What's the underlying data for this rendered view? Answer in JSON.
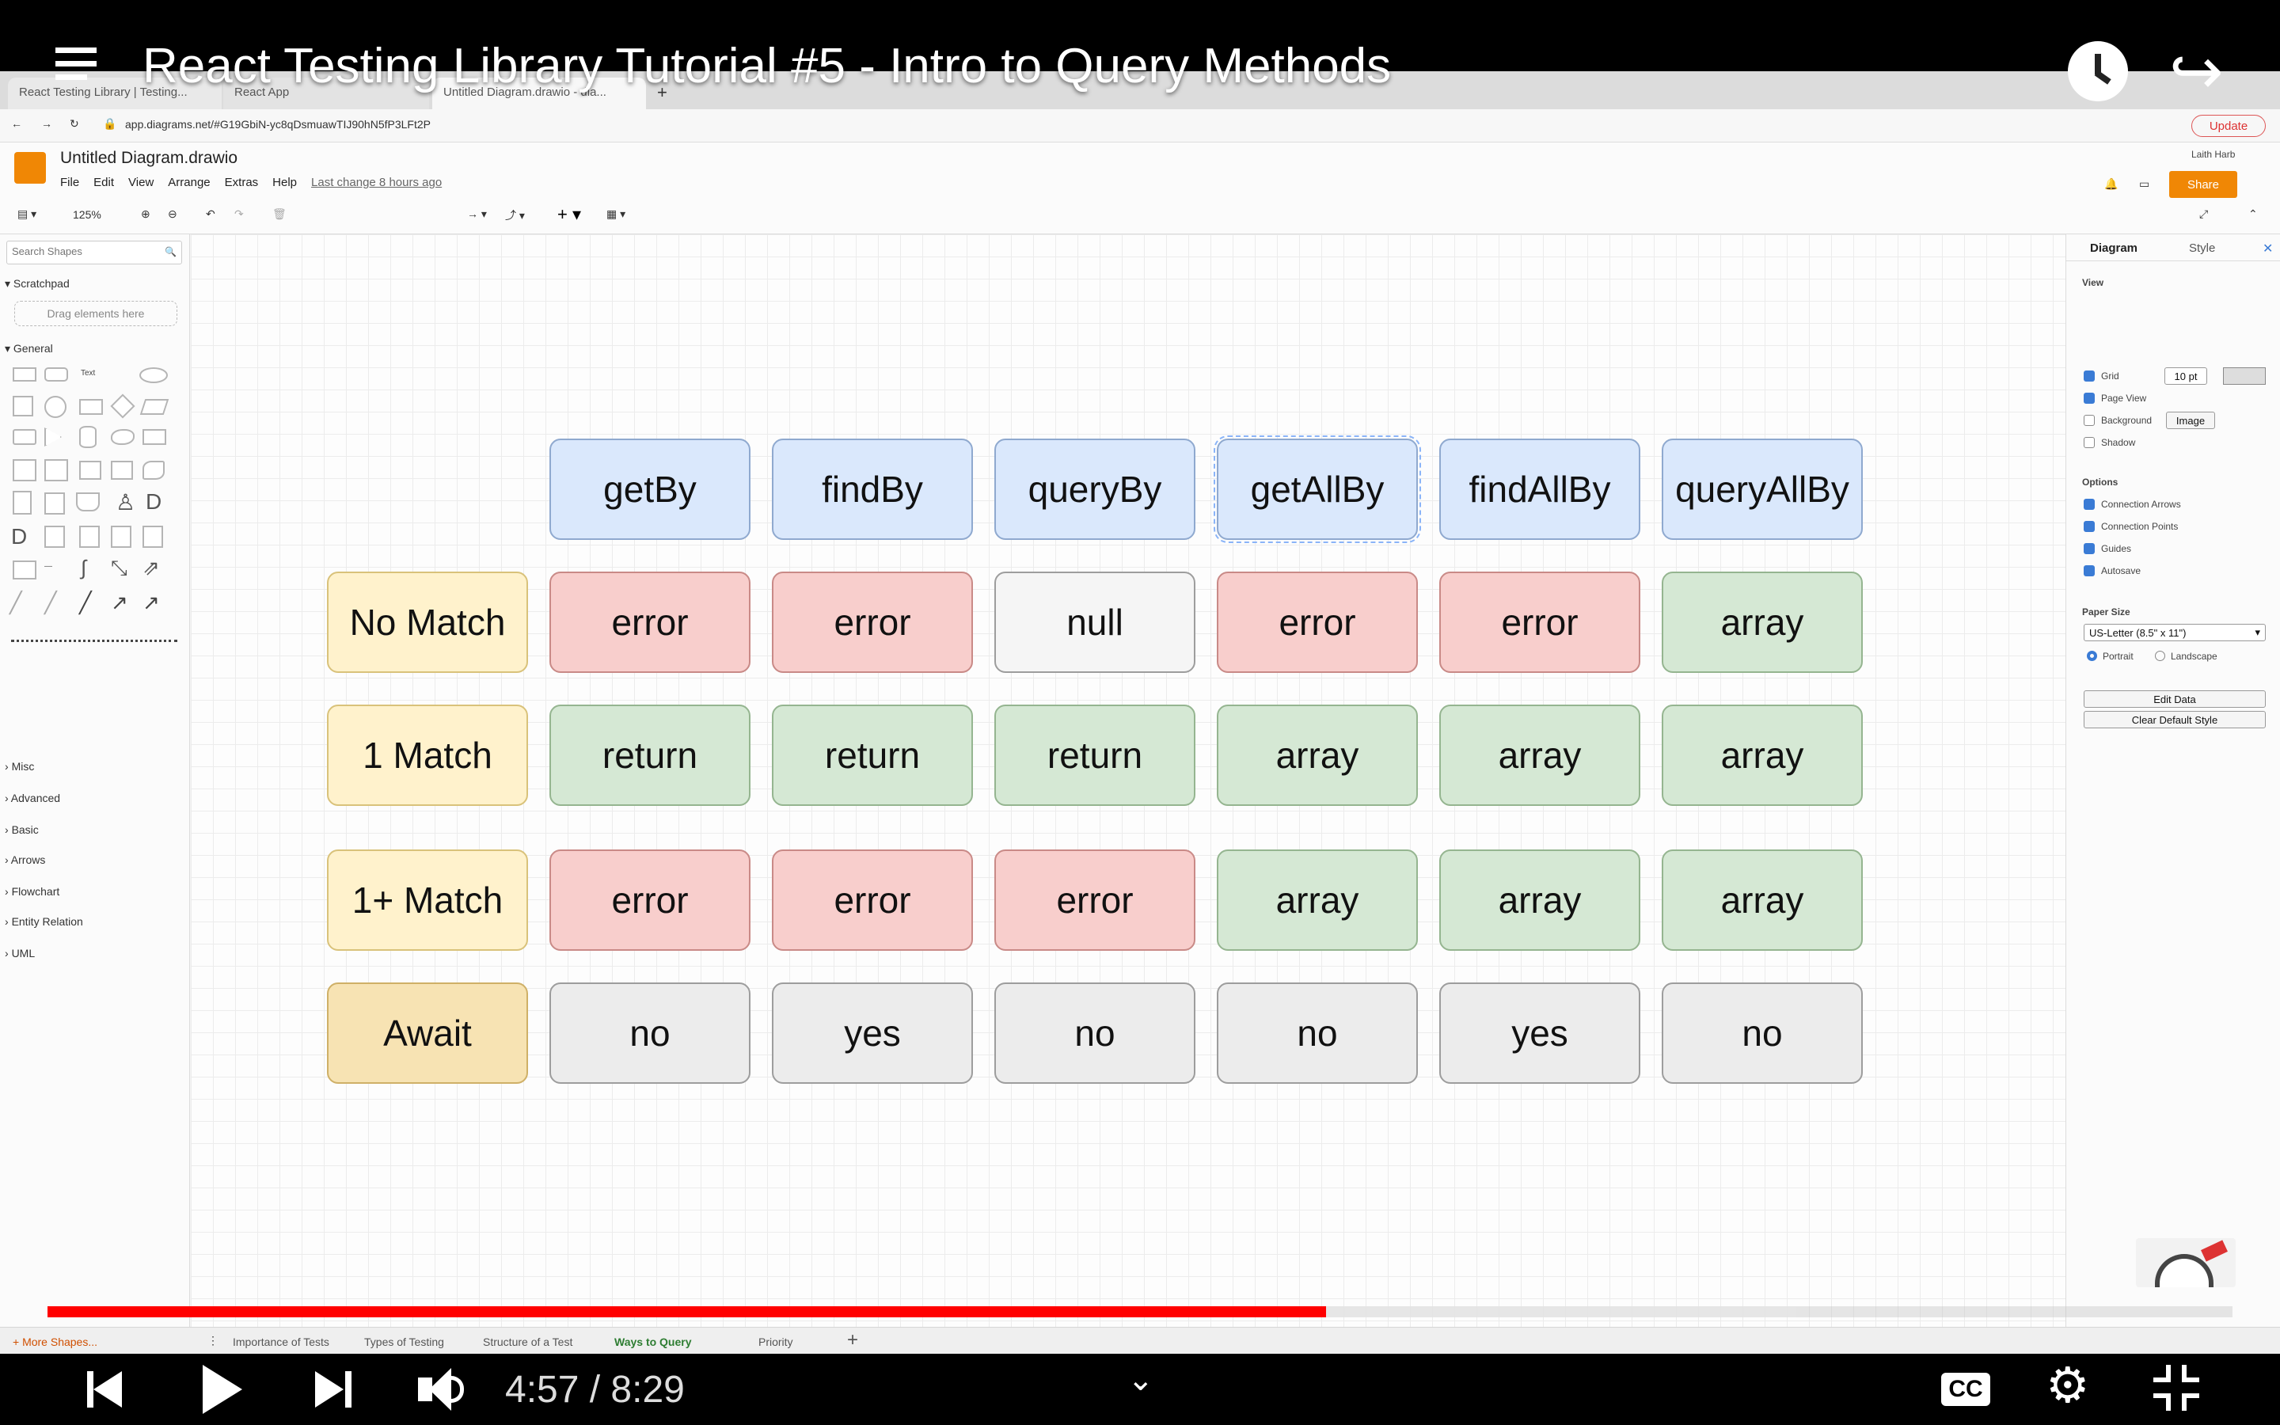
{
  "video": {
    "title": "React Testing Library Tutorial #5 - Intro to Query Methods",
    "time": "4:57 / 8:29",
    "progress_played": 0.585,
    "progress_buffered": 0.8
  },
  "browser": {
    "tabs": [
      "React Testing Library | Testing...",
      "React App",
      "Untitled Diagram.drawio - dia..."
    ],
    "url": "app.diagrams.net/#G19GbiN-yc8qDsmuawTIJ90hN5fP3LFt2P",
    "update_label": "Update"
  },
  "app": {
    "file_title": "Untitled Diagram.drawio",
    "menu": [
      "File",
      "Edit",
      "View",
      "Arrange",
      "Extras",
      "Help"
    ],
    "last_change": "Last change 8 hours ago",
    "user": "Laith Harb",
    "share_label": "Share",
    "zoom": "125%"
  },
  "left_panel": {
    "search_placeholder": "Search Shapes",
    "scratchpad": "Scratchpad",
    "drag_hint": "Drag elements here",
    "general": "General",
    "text_shape": "Text",
    "categories": [
      "Misc",
      "Advanced",
      "Basic",
      "Arrows",
      "Flowchart",
      "Entity Relation",
      "UML"
    ],
    "more_shapes": "+ More Shapes..."
  },
  "right_panel": {
    "tabs": [
      "Diagram",
      "Style"
    ],
    "view_heading": "View",
    "grid": "Grid",
    "grid_size": "10 pt",
    "page_view": "Page View",
    "background": "Background",
    "image_btn": "Image",
    "shadow": "Shadow",
    "options_heading": "Options",
    "connection_arrows": "Connection Arrows",
    "connection_points": "Connection Points",
    "guides": "Guides",
    "autosave": "Autosave",
    "paper_size_heading": "Paper Size",
    "paper_size": "US-Letter (8.5\" x 11\")",
    "portrait": "Portrait",
    "landscape": "Landscape",
    "edit_data": "Edit Data",
    "clear_default_style": "Clear Default Style"
  },
  "page_tabs": [
    "Importance of Tests",
    "Types of Testing",
    "Structure of a Test",
    "Ways to Query",
    "Priority"
  ],
  "active_page_tab": "Ways to Query",
  "diagram": {
    "columns": [
      "getBy",
      "findBy",
      "queryBy",
      "getAllBy",
      "findAllBy",
      "queryAllBy"
    ],
    "rows": [
      {
        "label": "No Match",
        "cells": [
          "error",
          "error",
          "null",
          "error",
          "error",
          "array"
        ]
      },
      {
        "label": "1 Match",
        "cells": [
          "return",
          "return",
          "return",
          "array",
          "array",
          "array"
        ]
      },
      {
        "label": "1+ Match",
        "cells": [
          "error",
          "error",
          "error",
          "array",
          "array",
          "array"
        ]
      },
      {
        "label": "Await",
        "cells": [
          "no",
          "yes",
          "no",
          "no",
          "yes",
          "no"
        ]
      }
    ]
  },
  "colors": {
    "header": "#dae8fc",
    "error": "#f8cecc",
    "ok": "#d5e8d4",
    "label": "#fff2cc",
    "neutral": "#f5f5f5",
    "progress": "#ff0000",
    "share": "#f08705"
  }
}
